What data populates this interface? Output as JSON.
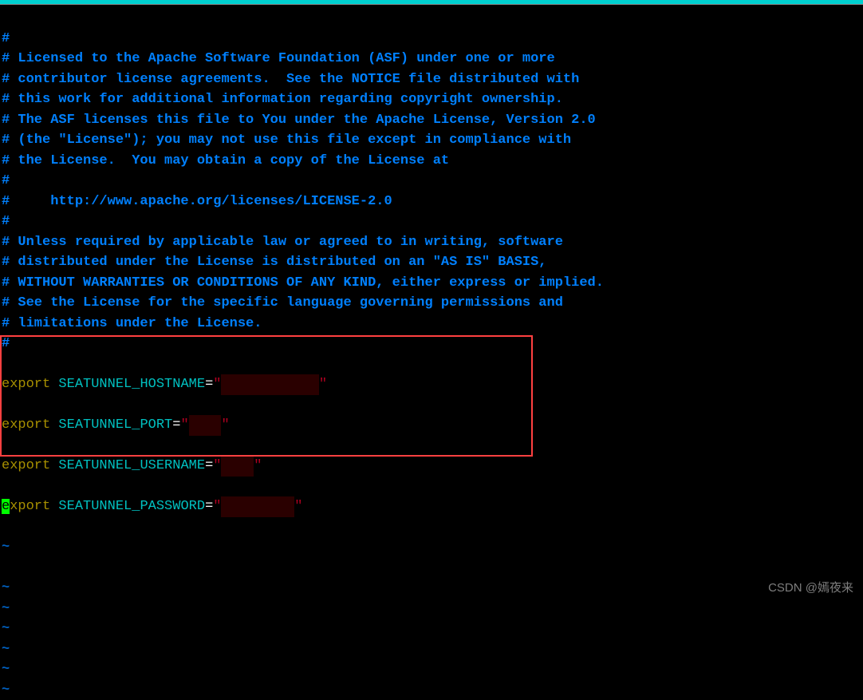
{
  "comments": {
    "l1": "#",
    "l2": "# Licensed to the Apache Software Foundation (ASF) under one or more",
    "l3": "# contributor license agreements.  See the NOTICE file distributed with",
    "l4": "# this work for additional information regarding copyright ownership.",
    "l5": "# The ASF licenses this file to You under the Apache License, Version 2.0",
    "l6": "# (the \"License\"); you may not use this file except in compliance with",
    "l7": "# the License.  You may obtain a copy of the License at",
    "l8": "#",
    "l9": "#     http://www.apache.org/licenses/LICENSE-2.0",
    "l10": "#",
    "l11": "# Unless required by applicable law or agreed to in writing, software",
    "l12": "# distributed under the License is distributed on an \"AS IS\" BASIS,",
    "l13": "# WITHOUT WARRANTIES OR CONDITIONS OF ANY KIND, either express or implied.",
    "l14": "# See the License for the specific language governing permissions and",
    "l15": "# limitations under the License.",
    "l16": "#"
  },
  "exports": {
    "keyword": "export",
    "var1": "SEATUNNEL_HOSTNAME",
    "var2": "SEATUNNEL_PORT",
    "var3": "SEATUNNEL_USERNAME",
    "var4": "SEATUNNEL_PASSWORD",
    "eq": "=",
    "quote": "\"",
    "cursor_keyword_first": "e",
    "cursor_keyword_rest": "xport",
    "keyword_prefix": "e",
    "keyword_rest": "xport"
  },
  "redacted": {
    "hostname": "            ",
    "port": "    ",
    "username": "    ",
    "password": "         "
  },
  "tilde": "~",
  "watermark": "CSDN @嫣夜来"
}
